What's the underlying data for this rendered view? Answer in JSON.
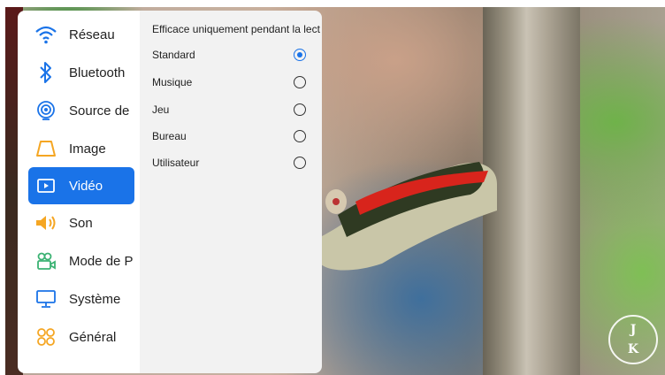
{
  "sidebar": {
    "items": [
      {
        "label": "Réseau",
        "icon": "wifi-icon"
      },
      {
        "label": "Bluetooth",
        "icon": "bluetooth-icon"
      },
      {
        "label": "Source de S",
        "icon": "source-icon"
      },
      {
        "label": "Image",
        "icon": "image-icon"
      },
      {
        "label": "Vidéo",
        "icon": "video-icon",
        "active": true
      },
      {
        "label": "Son",
        "icon": "speaker-icon"
      },
      {
        "label": "Mode de P",
        "icon": "projection-mode-icon"
      },
      {
        "label": "Système",
        "icon": "monitor-icon"
      },
      {
        "label": "Général",
        "icon": "general-icon"
      }
    ]
  },
  "panel": {
    "title": "Efficace uniquement pendant la lecture",
    "options": [
      {
        "label": "Standard",
        "selected": true
      },
      {
        "label": "Musique",
        "selected": false
      },
      {
        "label": "Jeu",
        "selected": false
      },
      {
        "label": "Bureau",
        "selected": false
      },
      {
        "label": "Utilisateur",
        "selected": false
      }
    ]
  },
  "watermark": {
    "top": "J",
    "bottom": "K"
  },
  "colors": {
    "accent": "#1a73e8",
    "icon_blue": "#1a73e8",
    "icon_orange": "#f5a623",
    "icon_green": "#3bb273"
  }
}
